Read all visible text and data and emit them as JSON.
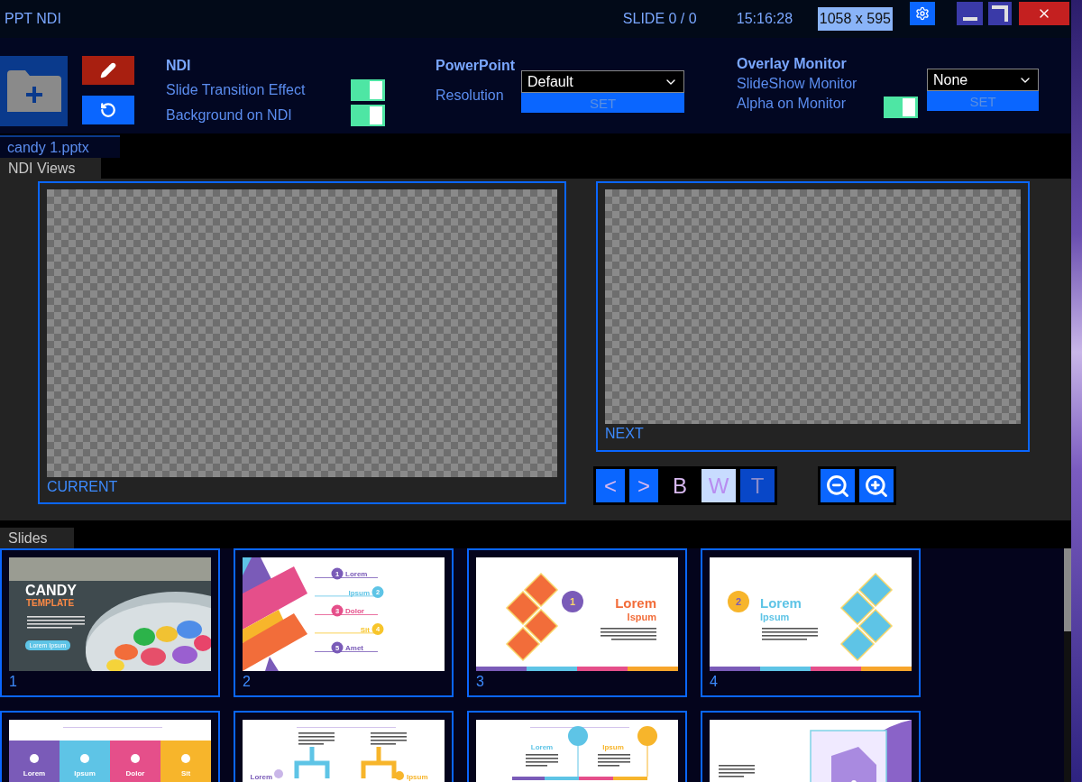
{
  "window": {
    "title": "PPT NDI",
    "slide_counter": "SLIDE 0 / 0",
    "clock": "15:16:28",
    "resolution": "1058 x 595"
  },
  "toolbar": {
    "ndi": {
      "heading": "NDI",
      "options": [
        {
          "label": "Slide Transition Effect",
          "on": true
        },
        {
          "label": "Background on NDI",
          "on": true
        }
      ]
    },
    "powerpoint": {
      "heading": "PowerPoint",
      "label": "Resolution",
      "value": "Default",
      "button": "SET"
    },
    "overlay": {
      "heading": "Overlay Monitor",
      "monitor_label": "SlideShow Monitor",
      "alpha_label": "Alpha on Monitor",
      "alpha_on": true,
      "value": "None",
      "button": "SET"
    }
  },
  "file_tab": "candy 1.pptx",
  "ndi_views": {
    "label": "NDI Views",
    "current_label": "CURRENT",
    "next_label": "NEXT",
    "controls": [
      {
        "label": "<",
        "kind": "nav",
        "selected": false
      },
      {
        "label": ">",
        "kind": "nav",
        "selected": false
      },
      {
        "label": "B",
        "kind": "black",
        "selected": false
      },
      {
        "label": "W",
        "kind": "white",
        "selected": true
      },
      {
        "label": "T",
        "kind": "transparent",
        "selected": false
      }
    ]
  },
  "slides": {
    "label": "Slides",
    "items": [
      {
        "number": "1",
        "kind": "cover",
        "texts": [
          "CANDY",
          "TEMPLATE",
          "Lorem Ipsum"
        ]
      },
      {
        "number": "2",
        "kind": "list",
        "texts": [
          "1",
          "Lorem",
          "2",
          "Ipsum",
          "3",
          "Dolor",
          "4",
          "Sit",
          "5",
          "Amet"
        ]
      },
      {
        "number": "3",
        "kind": "diamondsleft",
        "texts": [
          "1",
          "Lorem",
          "Ispum"
        ]
      },
      {
        "number": "4",
        "kind": "diamondsright",
        "texts": [
          "2",
          "Lorem",
          "Ipsum"
        ]
      },
      {
        "kind": "tiles",
        "texts": [
          "Lorem",
          "Ipsum",
          "Dolor",
          "Sit"
        ]
      },
      {
        "kind": "brackets",
        "texts": [
          "Lorem",
          "Ipsum"
        ]
      },
      {
        "kind": "timeline",
        "texts": [
          "Lorem",
          "Ipsum"
        ]
      },
      {
        "kind": "illustration"
      }
    ]
  }
}
